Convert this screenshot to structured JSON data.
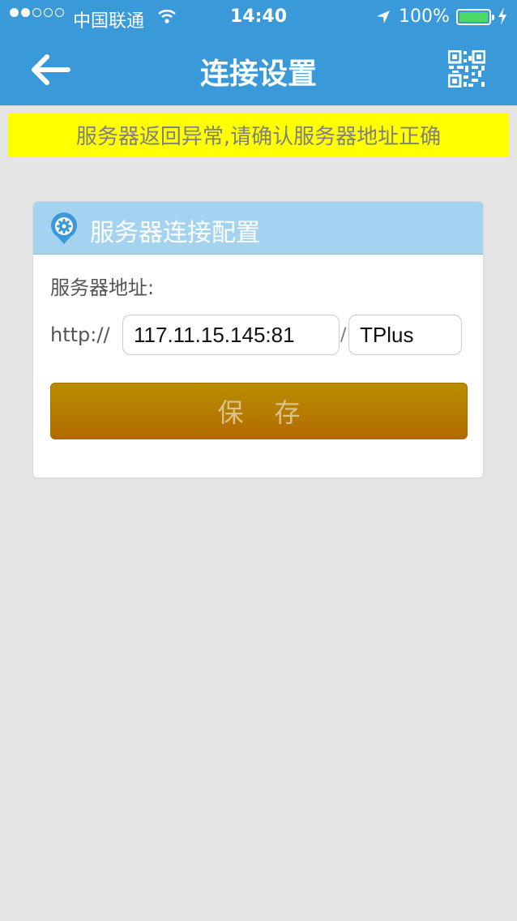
{
  "status_bar": {
    "carrier": "中国联通",
    "time": "14:40",
    "battery": "100%"
  },
  "navbar": {
    "title": "连接设置",
    "back_icon": "back-arrow-icon",
    "qr_icon": "qr-code-icon"
  },
  "alert": {
    "message": "服务器返回异常,请确认服务器地址正确"
  },
  "card": {
    "title": "服务器连接配置",
    "icon": "gear-icon",
    "address_label": "服务器地址:",
    "protocol": "http://",
    "host": "117.11.15.145:81",
    "separator": "/",
    "path": "TPlus",
    "save_label": "保存"
  },
  "colors": {
    "primary": "#3a9ad9",
    "alert_bg": "#ffff00",
    "card_header": "#a4d3f0",
    "save_button": "#b47e00"
  }
}
